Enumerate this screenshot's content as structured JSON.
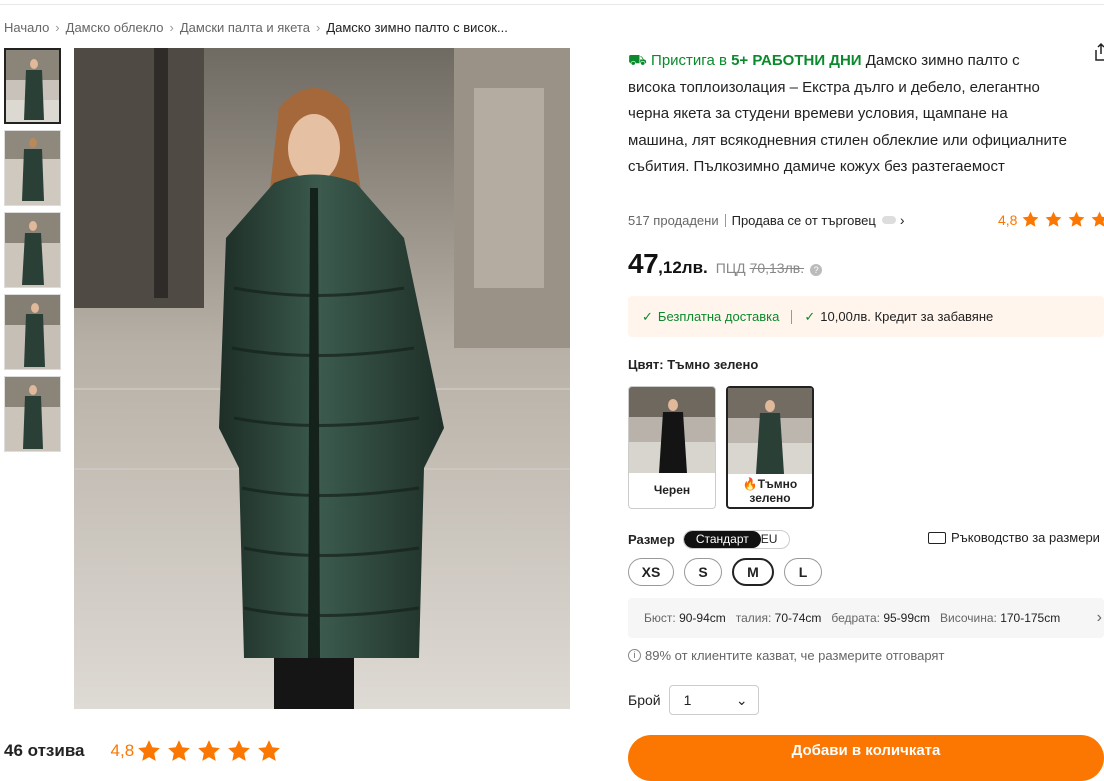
{
  "breadcrumb": [
    "Начало",
    "Дамско облекло",
    "Дамски палта и якета",
    "Дамско зимно палто с висок..."
  ],
  "product": {
    "delivery_prefix": "Пристига в ",
    "delivery_days": "5+ РАБОТНИ ДНИ",
    "title": " Дамско зимно палто с висока топлоизолация – Екстра дълго и дебело, елегантно черна якета за студени времеви условия, щампане на машина, лят всякодневния стилен облеклие или официалните събития. Пълкозимно дамиче кожух без разтегаемост",
    "sold": "517 продадени",
    "seller": "Продава се от търговец",
    "rating": "4,8",
    "stars": 5,
    "price_int": "47",
    "price_frac": ",12лв.",
    "price_old_label": "ПЦД",
    "price_old": "70,13лв.",
    "free_delivery": "Безплатна доставка",
    "credit": "10,00лв. Кредит за забавяне"
  },
  "color": {
    "label": "Цвят: Тъмно зелено",
    "options": [
      {
        "name": "Черен"
      },
      {
        "name": "Тъмно зелено"
      }
    ]
  },
  "size": {
    "label": "Размер",
    "toggle": [
      "Стандарт",
      "EU"
    ],
    "guide": "Ръководство за размери",
    "options": [
      "XS",
      "S",
      "M",
      "L"
    ],
    "selected": "M",
    "measure": {
      "bust_label": "Бюст:",
      "bust": "90-94cm",
      "waist_label": "талия:",
      "waist": "70-74cm",
      "hips_label": "бедрата:",
      "hips": "95-99cm",
      "height_label": "Височина:",
      "height": "170-175cm"
    },
    "fit": "89% от клиентите казват, че размерите отговарят"
  },
  "quantity": {
    "label": "Брой",
    "value": "1"
  },
  "cart": {
    "label": "Добави в количката"
  },
  "reviews": {
    "count": "46 отзива",
    "rating": "4,8",
    "stars": 5
  },
  "colors": {
    "accent": "#fb7701",
    "green": "#0a8a2c",
    "coat": "#2a3f36"
  }
}
